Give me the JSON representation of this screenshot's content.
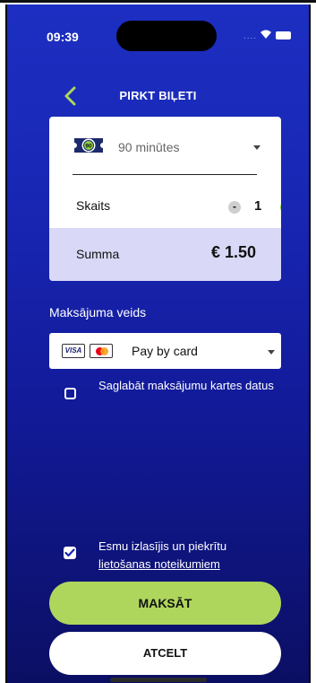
{
  "status_bar": {
    "time": "09:39",
    "signal_dots": "...."
  },
  "header": {
    "title": "PIRKT BIĻETI"
  },
  "ticket": {
    "badge": "90",
    "type_label": "90 minūtes",
    "quantity_label": "Skaits",
    "quantity": "1",
    "minus": "-",
    "plus": "+",
    "sum_label": "Summa",
    "sum_value": "€ 1.50"
  },
  "payment": {
    "section_title": "Maksājuma veids",
    "visa_text": "VISA",
    "method_label": "Pay by card",
    "save_card_label": "Saglabāt maksājumu kartes datus"
  },
  "terms": {
    "text": "Esmu izlasījis un piekrītu",
    "link": "lietošanas noteikumiem"
  },
  "actions": {
    "pay_label": "MAKSĀT",
    "cancel_label": "ATCELT"
  },
  "colors": {
    "accent_green": "#afd65c",
    "plus_green": "#8ed13f",
    "background_blue": "#1826b3",
    "sum_row": "#d9d9f7"
  }
}
